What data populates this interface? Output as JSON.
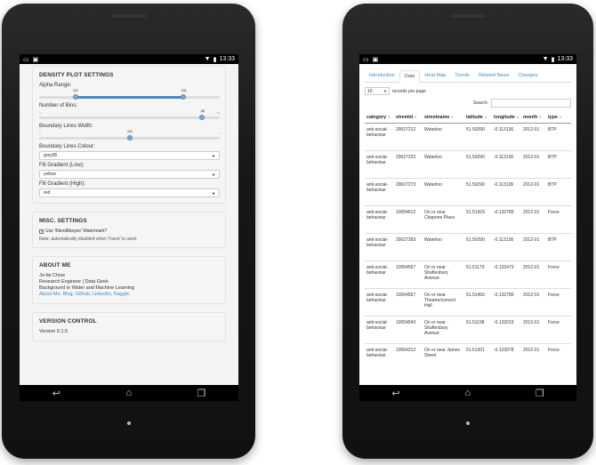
{
  "status": {
    "time": "13:33"
  },
  "left": {
    "density": {
      "heading": "DENSITY PLOT SETTINGS",
      "alpha_label": "Alpha Range:",
      "alpha_low": "0.2",
      "alpha_high": "0.8",
      "bins_label": "Number of Bins:",
      "bins_value": "45",
      "bins_min": "0",
      "bins_max": "50",
      "lines_label": "Boundary Lines Width:",
      "lines_value": "0.5",
      "lines_min": "0",
      "lines_max": "1",
      "colour_label": "Boundary Lines Colour:",
      "colour_value": "grey95",
      "low_label": "Fill Gradient (Low):",
      "low_value": "yellow",
      "high_label": "Fill Gradient (High):",
      "high_value": "red"
    },
    "misc": {
      "heading": "MISC. SETTINGS",
      "watermark_label": "Use 'Blenditbayes' Watermark?",
      "note": "Note: automatically disabled when 'Facet' is used."
    },
    "about": {
      "heading": "ABOUT ME",
      "name": "Jo-fai Chow",
      "role": "Research Engineer | Data Geek",
      "background": "Background in Water and Machine Learning",
      "links": [
        "About Me",
        "Blog",
        "Github",
        "LinkedIn",
        "Kaggle"
      ]
    },
    "version": {
      "heading": "VERSION CONTROL",
      "value": "Version 0.1.5"
    }
  },
  "right": {
    "tabs": [
      "Introduction",
      "Data",
      "Heat Map",
      "Trends",
      "Related News",
      "Changes"
    ],
    "active_tab": 1,
    "length_value": "10",
    "length_suffix": "records per page",
    "search_label": "Search:",
    "columns": [
      "category",
      "streetid",
      "streetname",
      "latitude",
      "longitude",
      "month",
      "type"
    ],
    "rows": [
      [
        "anti-social-behaviour",
        "29027212",
        "Waterloo",
        "51.50290",
        "-0.113136",
        "2012-01",
        "BTP"
      ],
      [
        "anti-social-behaviour",
        "29027222",
        "Waterloo",
        "51.50290",
        "-0.113136",
        "2012-01",
        "BTP"
      ],
      [
        "anti-social-behaviour",
        "29027273",
        "Waterloo",
        "51.50290",
        "-0.113136",
        "2012-01",
        "BTP"
      ],
      [
        "anti-social-behaviour",
        "10054612",
        "On or near Chapone Place",
        "51.51429",
        "-0.132789",
        "2012-01",
        "Force"
      ],
      [
        "anti-social-behaviour",
        "29027283",
        "Waterloo",
        "51.50290",
        "-0.113136",
        "2012-01",
        "BTP"
      ],
      [
        "anti-social-behaviour",
        "10054567",
        "On or near Shaftesbury Avenue",
        "51.51179",
        "-0.132473",
        "2012-01",
        "Force"
      ],
      [
        "anti-social-behaviour",
        "10054557",
        "On or near Theatre/concert Hall",
        "51.51450",
        "-0.132780",
        "2012-01",
        "Force"
      ],
      [
        "anti-social-behaviour",
        "10054543",
        "On or near Shaftesbury Avenue",
        "51.51198",
        "-0.132019",
        "2012-01",
        "Force"
      ],
      [
        "anti-social-behaviour",
        "10054312",
        "On or near James Street",
        "51.51301",
        "-0.123978",
        "2012-01",
        "Force"
      ]
    ]
  }
}
